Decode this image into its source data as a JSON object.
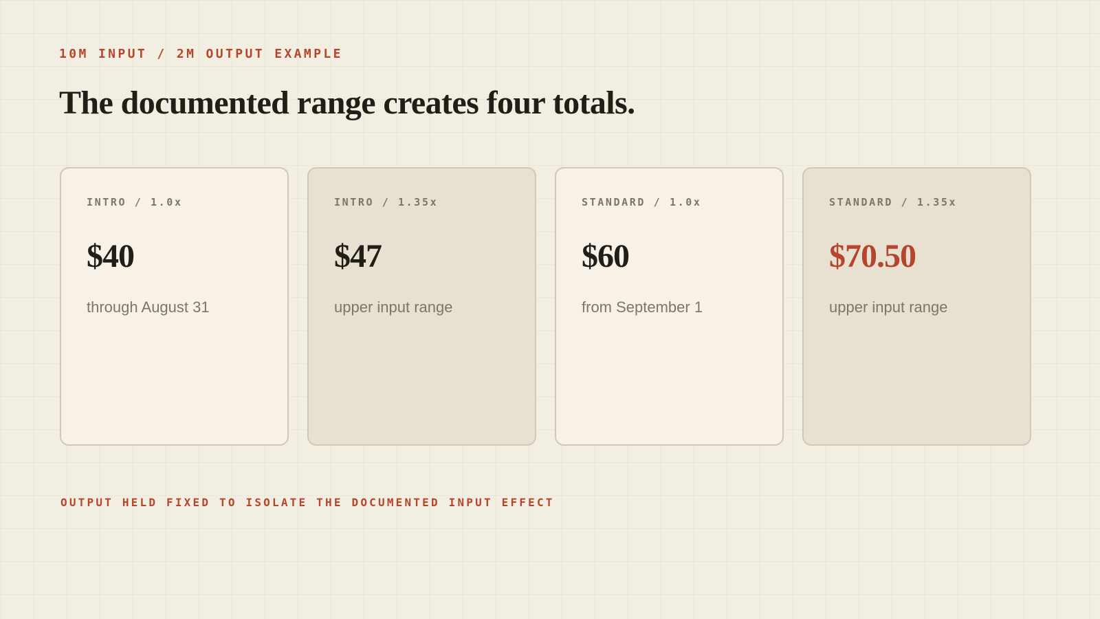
{
  "header": {
    "eyebrow": "10M INPUT / 2M OUTPUT EXAMPLE",
    "title": "The documented range creates four totals."
  },
  "cards": [
    {
      "label": "INTRO / 1.0x",
      "price": "$40",
      "note": "through August 31"
    },
    {
      "label": "INTRO / 1.35x",
      "price": "$47",
      "note": "upper input range"
    },
    {
      "label": "STANDARD / 1.0x",
      "price": "$60",
      "note": "from September 1"
    },
    {
      "label": "STANDARD / 1.35x",
      "price": "$70.50",
      "note": "upper input range"
    }
  ],
  "footer": {
    "note": "OUTPUT HELD FIXED TO ISOLATE THE DOCUMENTED INPUT EFFECT"
  },
  "colors": {
    "background": "#f2eee2",
    "accent": "#b5452c",
    "text_dark": "#1f1f17",
    "text_muted": "#7b766b",
    "card_light": "#f8f1e7",
    "card_dark": "#e8e1d2",
    "card_border": "#d2c8b8"
  }
}
